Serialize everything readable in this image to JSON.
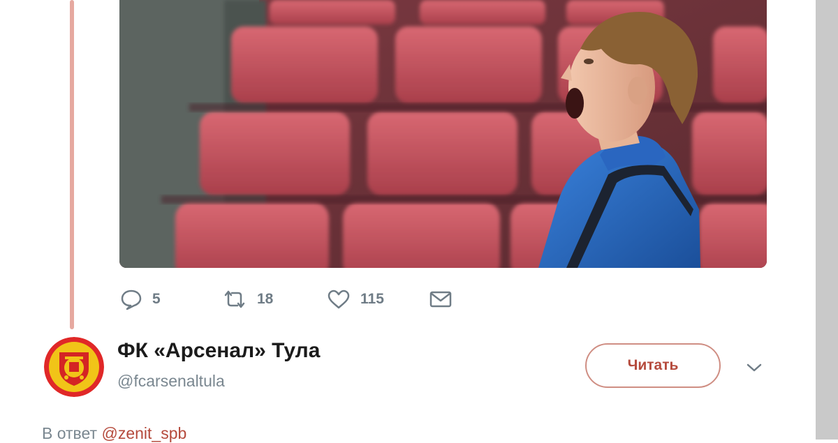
{
  "tweet": {
    "actions": {
      "reply": {
        "icon": "reply-icon",
        "count": "5"
      },
      "retweet": {
        "icon": "retweet-icon",
        "count": "18"
      },
      "like": {
        "icon": "heart-icon",
        "count": "115"
      },
      "dm": {
        "icon": "envelope-icon"
      }
    }
  },
  "next_tweet": {
    "display_name": "ФК «Арсенал» Тула",
    "handle": "@fcarsenaltula",
    "follow_label": "Читать",
    "reply_prefix": "В ответ",
    "reply_mention": "@zenit_spb"
  },
  "colors": {
    "accent": "#b54a3c",
    "thread_line": "#e6a9a0",
    "muted_text": "#7a8790",
    "seat_red": "#c0525d",
    "jacket_blue": "#2d6cc4"
  }
}
